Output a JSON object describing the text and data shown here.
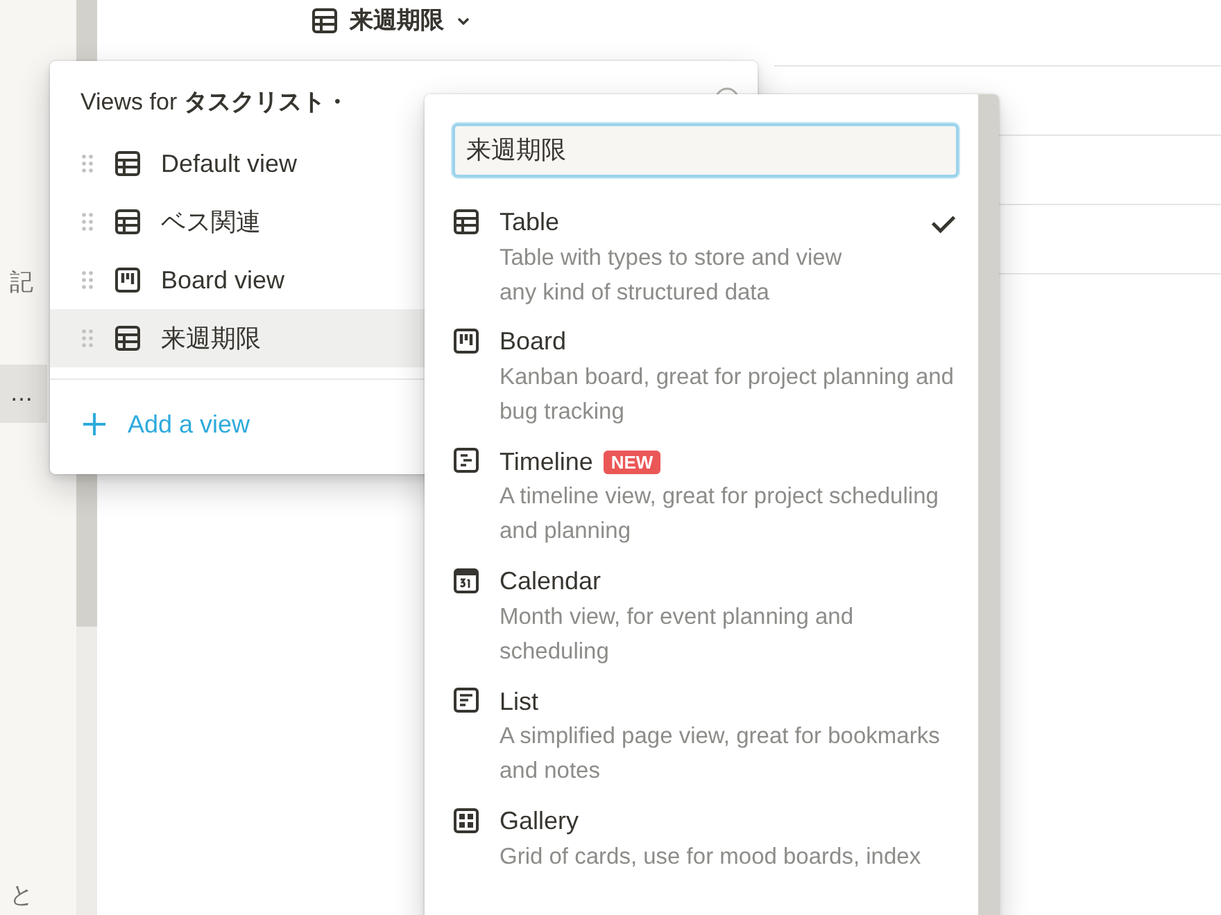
{
  "sidebar": {
    "items": [
      {
        "label": "記",
        "selected": false
      },
      {
        "label": "…",
        "selected": true
      },
      {
        "label": "と",
        "selected": false
      }
    ]
  },
  "header": {
    "title": "来週期限"
  },
  "views_panel": {
    "title_prefix": "Views for",
    "title_name": "タスクリスト・",
    "views": [
      {
        "kind": "table",
        "label": "Default view",
        "selected": false
      },
      {
        "kind": "table",
        "label": "ベス関連",
        "selected": false
      },
      {
        "kind": "board",
        "label": "Board view",
        "selected": false
      },
      {
        "kind": "table",
        "label": "来週期限",
        "selected": true
      }
    ],
    "add_label": "Add a view"
  },
  "type_menu": {
    "name_value": "来週期限",
    "types": [
      {
        "kind": "table",
        "label": "Table",
        "description": "Table with types to store and view any kind of structured data",
        "checked": true
      },
      {
        "kind": "board",
        "label": "Board",
        "description": "Kanban board, great for project planning and bug tracking",
        "checked": false
      },
      {
        "kind": "timeline",
        "label": "Timeline",
        "badge": "NEW",
        "description": "A timeline view, great for project scheduling and planning",
        "checked": false
      },
      {
        "kind": "calendar",
        "label": "Calendar",
        "description": "Month view, for event planning and scheduling",
        "checked": false
      },
      {
        "kind": "list",
        "label": "List",
        "description": "A simplified page view, great for bookmarks and notes",
        "checked": false
      },
      {
        "kind": "gallery",
        "label": "Gallery",
        "description": "Grid of cards, use for mood boards, index",
        "checked": false
      }
    ]
  }
}
